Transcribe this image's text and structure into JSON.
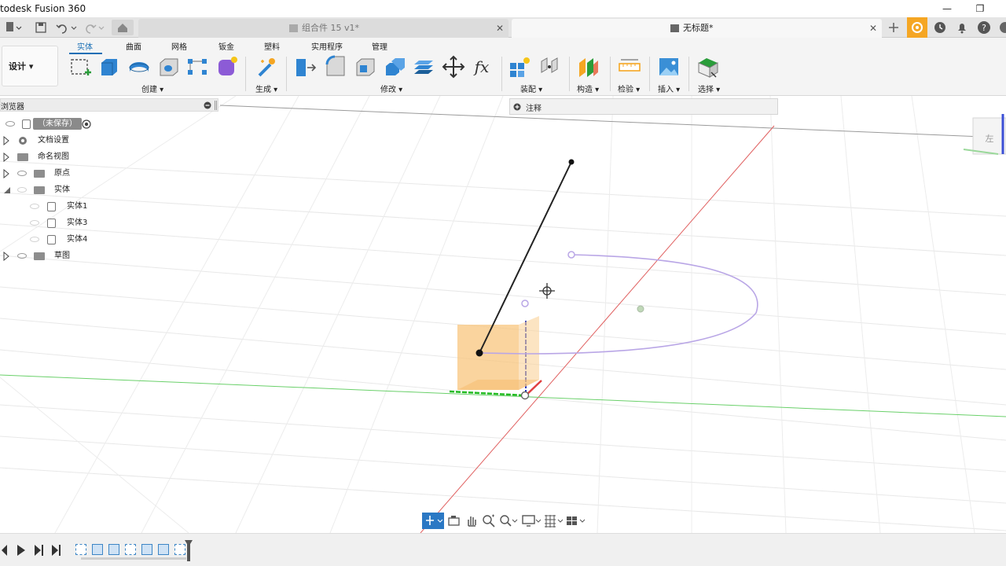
{
  "app": {
    "title": "todesk Fusion 360"
  },
  "window_controls": {
    "minimize": "—",
    "restore": "❐"
  },
  "tabs": [
    {
      "label": "组合件 15 v1*",
      "active": false
    },
    {
      "label": "无标题*",
      "active": true
    }
  ],
  "ribbon": {
    "workspace": "设计 ▾",
    "tabs": [
      "实体",
      "曲面",
      "网格",
      "钣金",
      "塑料",
      "实用程序",
      "管理"
    ],
    "active_tab": "实体",
    "groups": [
      "创建 ▾",
      "生成 ▾",
      "修改 ▾",
      "装配 ▾",
      "构造 ▾",
      "检验 ▾",
      "插入 ▾",
      "选择 ▾"
    ]
  },
  "browser": {
    "title": "浏览器",
    "root": "（未保存）",
    "items": [
      "文档设置",
      "命名视图",
      "原点",
      "实体"
    ],
    "bodies": [
      "实体1",
      "实体3",
      "实体4"
    ],
    "sketches": "草图"
  },
  "annotation_bar": {
    "label": "注释"
  },
  "viewcube": {
    "face": "左"
  },
  "colors": {
    "accent": "#1a6fb5",
    "orange": "#f0a030",
    "sketch_purple": "#b9a6e6",
    "axis_red": "#e04040",
    "axis_green": "#33cc33",
    "axis_blue": "#2233bb"
  }
}
